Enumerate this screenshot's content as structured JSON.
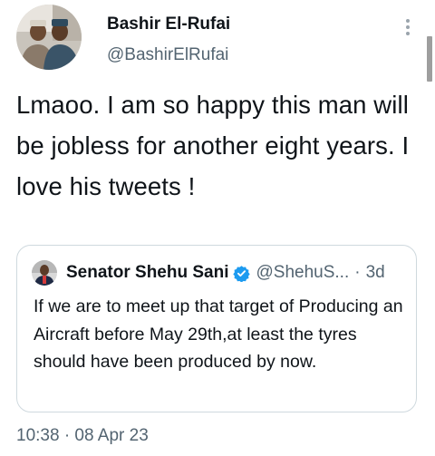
{
  "author": {
    "name": "Bashir El-Rufai",
    "handle": "@BashirElRufai",
    "avatar_icon": "profile-photo"
  },
  "more_icon": "more-vertical-icon",
  "tweet": {
    "text": "Lmaoo. I am so happy this man will be jobless for another eight years. I love his tweets !"
  },
  "quoted": {
    "name": "Senator Shehu Sani",
    "handle": "@ShehuS...",
    "separator": "·",
    "time": "3d",
    "verified_color": "#1d9bf0",
    "text": "If we are to meet up that target of Producing an Aircraft before May 29th,at least the tyres should have been produced by now."
  },
  "meta": {
    "timestamp": "10:38 · 08 Apr 23"
  }
}
